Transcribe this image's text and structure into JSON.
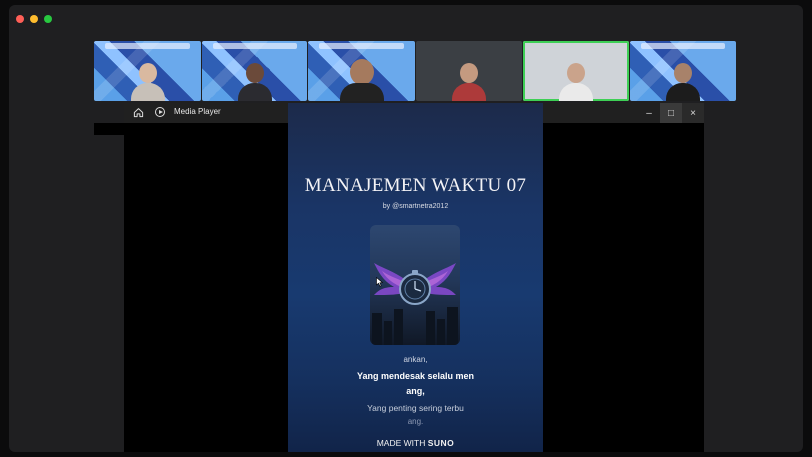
{
  "window": {
    "traffic_lights": [
      {
        "name": "close",
        "color": "#ff5f57"
      },
      {
        "name": "minimize",
        "color": "#febc2e"
      },
      {
        "name": "maximize",
        "color": "#28c840"
      }
    ]
  },
  "participants": [
    {
      "type": "slide",
      "person": {
        "skin": "#d9b9a0",
        "shirt": "#c7c0b8"
      }
    },
    {
      "type": "slide",
      "person": {
        "skin": "#6b4a3a",
        "shirt": "#2b2b30"
      }
    },
    {
      "type": "slide",
      "person": {
        "skin": "#a57a5e",
        "shirt": "#222222"
      }
    },
    {
      "type": "camera",
      "person": {
        "skin": "#c49a80",
        "shirt": "#ad3a3a"
      }
    },
    {
      "type": "camera",
      "active": true,
      "person": {
        "skin": "#caa38b",
        "shirt": "#eaeaea"
      }
    },
    {
      "type": "slide",
      "person": {
        "skin": "#a8826a",
        "shirt": "#1c1c1c"
      }
    }
  ],
  "media_player": {
    "app_label": "Media Player",
    "controls": {
      "minimize": "–",
      "maximize": "□",
      "close": "×"
    },
    "video": {
      "title": "MANAJEMEN WAKTU 07",
      "by_line": "by @smartnetra2012",
      "lyrics": [
        "ankan,",
        "Yang mendesak selalu men",
        "ang,",
        "Yang penting sering terbu",
        "ang."
      ],
      "credit_prefix": "MADE WITH",
      "credit_brand": "SUNO"
    }
  }
}
